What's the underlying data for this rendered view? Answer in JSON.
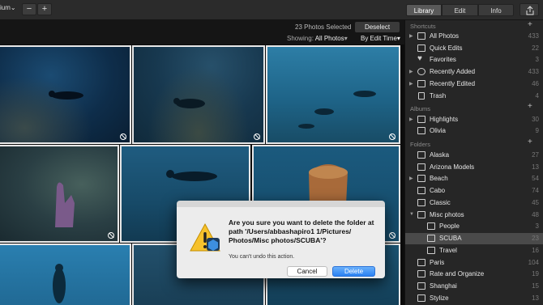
{
  "toolbar": {
    "zoom_label": "ium",
    "minus": "−",
    "plus": "+",
    "tabs": [
      {
        "label": "Library"
      },
      {
        "label": "Edit"
      },
      {
        "label": "Info"
      }
    ]
  },
  "browser": {
    "selected_count": "23 Photos Selected",
    "deselect_label": "Deselect",
    "showing_label": "Showing:",
    "showing_value": "All Photos",
    "sort_label": "By Edit Time"
  },
  "sidebar": {
    "shortcuts_header": "Shortcuts",
    "shortcuts": [
      {
        "label": "All Photos",
        "count": "433",
        "icon": "photos-icon"
      },
      {
        "label": "Quick Edits",
        "count": "22",
        "icon": "quick-edits-icon"
      },
      {
        "label": "Favorites",
        "count": "3",
        "icon": "heart-icon"
      },
      {
        "label": "Recently Added",
        "count": "433",
        "icon": "plus-circle-icon"
      },
      {
        "label": "Recently Edited",
        "count": "46",
        "icon": "recently-edited-icon"
      },
      {
        "label": "Trash",
        "count": "4",
        "icon": "trash-icon"
      }
    ],
    "albums_header": "Albums",
    "albums": [
      {
        "label": "Highlights",
        "count": "30"
      },
      {
        "label": "Olivia",
        "count": "9"
      }
    ],
    "folders_header": "Folders",
    "folders": [
      {
        "label": "Alaska",
        "count": "27"
      },
      {
        "label": "Arizona Models",
        "count": "13"
      },
      {
        "label": "Beach",
        "count": "54"
      },
      {
        "label": "Cabo",
        "count": "74"
      },
      {
        "label": "Classic",
        "count": "45"
      },
      {
        "label": "Misc photos",
        "count": "48"
      },
      {
        "label": "People",
        "count": "3"
      },
      {
        "label": "SCUBA",
        "count": "23"
      },
      {
        "label": "Travel",
        "count": "16"
      },
      {
        "label": "Paris",
        "count": "104"
      },
      {
        "label": "Rate and Organize",
        "count": "19"
      },
      {
        "label": "Shanghai",
        "count": "15"
      },
      {
        "label": "Stylize",
        "count": "13"
      }
    ]
  },
  "dialog": {
    "title": "Are you sure you want to delete the folder at path '/Users/abbashapiro1 1/Pictures/ Photos/Misc photos/SCUBA'?",
    "message": "You can't undo this action.",
    "cancel_label": "Cancel",
    "delete_label": "Delete"
  },
  "colors": {
    "accent": "#2a82f3",
    "selected_border": "#e8e8e8",
    "sidebar_bg": "#262626"
  }
}
